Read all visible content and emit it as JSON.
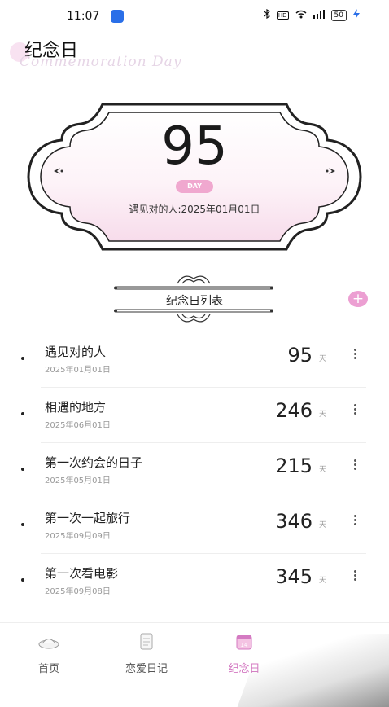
{
  "status_bar": {
    "time": "11:07",
    "icons": [
      "bluetooth-icon",
      "hd-icon",
      "wifi-icon",
      "signal-icon",
      "battery-icon",
      "charging-icon"
    ],
    "battery_text": "50",
    "hd_text": "HD"
  },
  "header": {
    "title": "纪念日",
    "subtitle": "Commemoration Day"
  },
  "counter": {
    "days": "95",
    "unit_badge": "DAY",
    "caption": "遇见对的人:2025年01月01日"
  },
  "list": {
    "title": "纪念日列表",
    "add_label": "+",
    "unit": "天",
    "items": [
      {
        "name": "遇见对的人",
        "date": "2025年01月01日",
        "days": "95"
      },
      {
        "name": "相遇的地方",
        "date": "2025年06月01日",
        "days": "246"
      },
      {
        "name": "第一次约会的日子",
        "date": "2025年05月01日",
        "days": "215"
      },
      {
        "name": "第一次一起旅行",
        "date": "2025年09月09日",
        "days": "346"
      },
      {
        "name": "第一次看电影",
        "date": "2025年09月08日",
        "days": "345"
      }
    ]
  },
  "bottom_nav": {
    "items": [
      {
        "label": "首页",
        "icon": "home-icon"
      },
      {
        "label": "恋爱日记",
        "icon": "diary-icon"
      },
      {
        "label": "纪念日",
        "icon": "calendar-icon",
        "active": true
      }
    ]
  },
  "colors": {
    "accent_pink": "#ec9fd2",
    "badge_pink": "#f0a8cf",
    "frame_fill": "#fbeaf3",
    "active_tab": "#d47ac2"
  }
}
